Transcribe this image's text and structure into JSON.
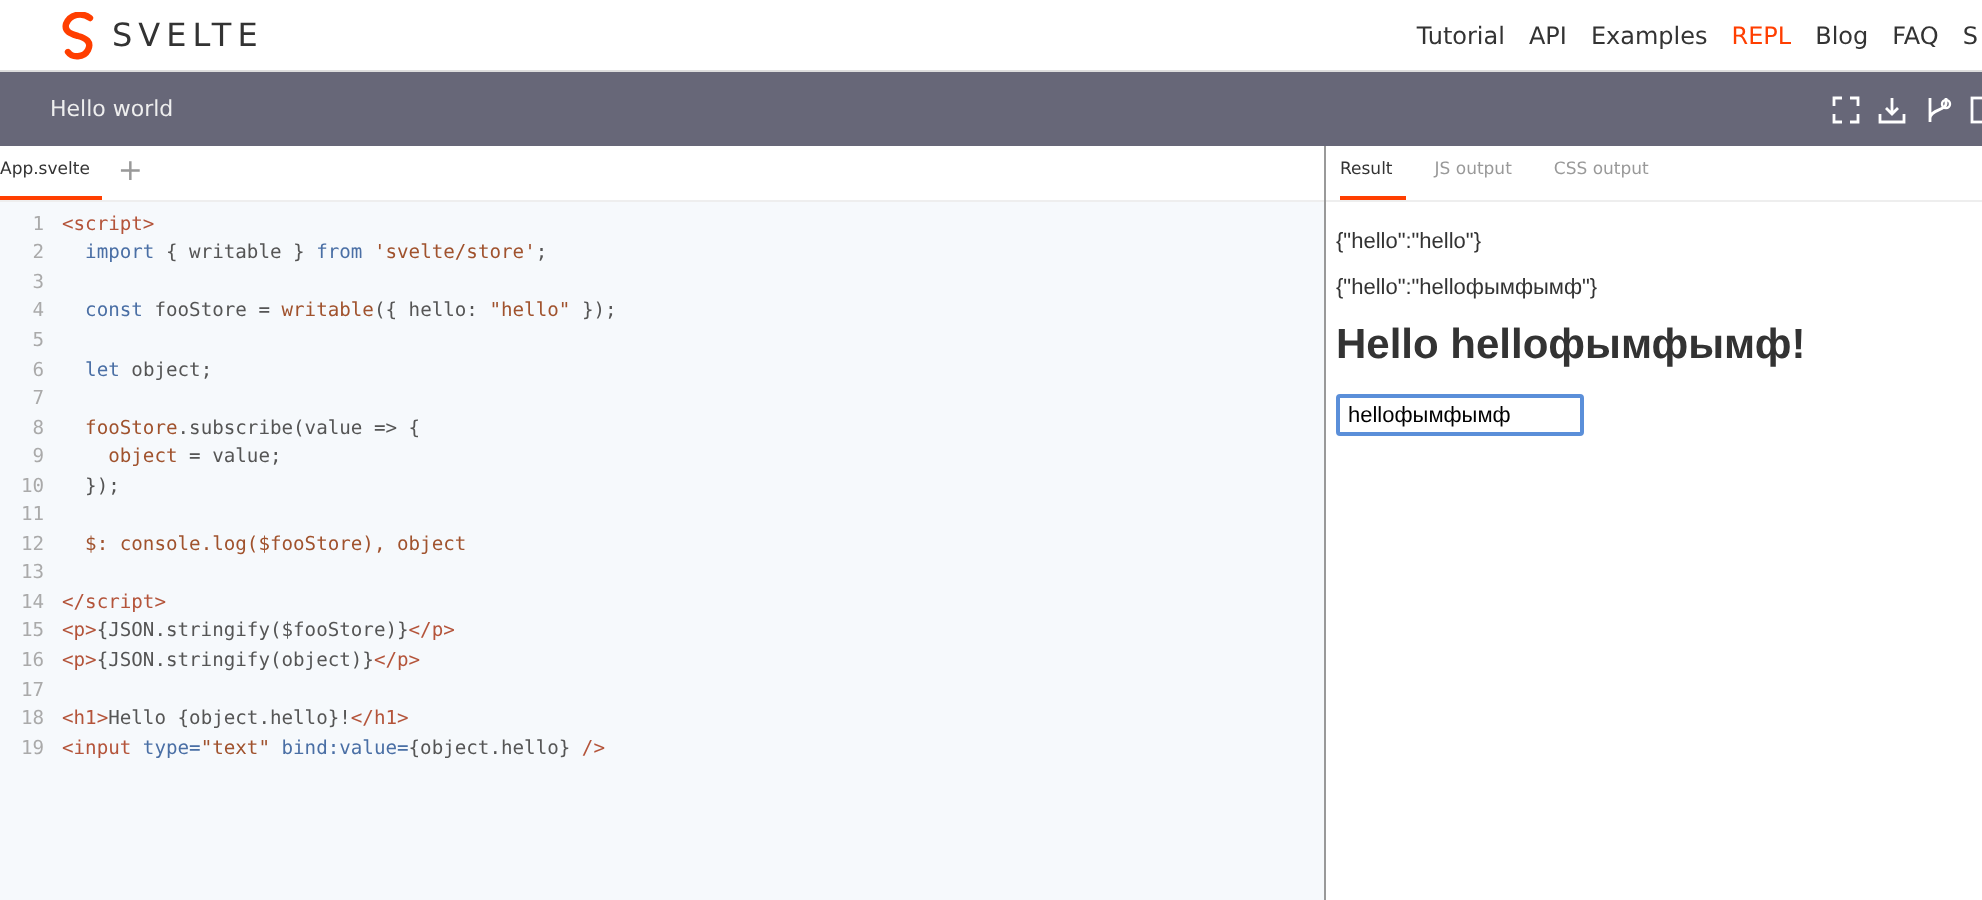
{
  "header": {
    "logo": "SVELTE",
    "nav": [
      {
        "label": "Tutorial",
        "selected": false
      },
      {
        "label": "API",
        "selected": false
      },
      {
        "label": "Examples",
        "selected": false
      },
      {
        "label": "REPL",
        "selected": true
      },
      {
        "label": "Blog",
        "selected": false
      },
      {
        "label": "FAQ",
        "selected": false
      },
      {
        "label": "S",
        "selected": false
      }
    ]
  },
  "toolbar": {
    "title": "Hello world"
  },
  "editor": {
    "tabs": [
      {
        "label": "App.svelte",
        "selected": true
      }
    ],
    "add_tab": "+",
    "lines": [
      {
        "number": "1",
        "tokens": [
          {
            "kind": "tag",
            "text": "<script>"
          }
        ]
      },
      {
        "number": "2",
        "tokens": [
          {
            "kind": "keyword",
            "text": "  import"
          },
          {
            "kind": "plain",
            "text": " { writable } "
          },
          {
            "kind": "keyword",
            "text": "from"
          },
          {
            "kind": "string",
            "text": " 'svelte/store'"
          },
          {
            "kind": "plain",
            "text": ";"
          }
        ]
      },
      {
        "number": "3"
      },
      {
        "number": "4",
        "tokens": [
          {
            "kind": "keyword",
            "text": "  const"
          },
          {
            "kind": "plain",
            "text": " fooStore = "
          },
          {
            "kind": "var",
            "text": "writable"
          },
          {
            "kind": "plain",
            "text": "({ hello: "
          },
          {
            "kind": "string",
            "text": "\"hello\""
          },
          {
            "kind": "plain",
            "text": " });"
          }
        ]
      },
      {
        "number": "5"
      },
      {
        "number": "6",
        "tokens": [
          {
            "kind": "keyword",
            "text": "  let"
          },
          {
            "kind": "plain",
            "text": " object;"
          }
        ]
      },
      {
        "number": "7"
      },
      {
        "number": "8",
        "tokens": [
          {
            "kind": "var",
            "text": "  fooStore"
          },
          {
            "kind": "plain",
            "text": ".subscribe(value => {"
          }
        ]
      },
      {
        "number": "9",
        "tokens": [
          {
            "kind": "var",
            "text": "    object"
          },
          {
            "kind": "plain",
            "text": " = value;"
          }
        ]
      },
      {
        "number": "10",
        "tokens": [
          {
            "kind": "plain",
            "text": "  });"
          }
        ]
      },
      {
        "number": "11"
      },
      {
        "number": "12",
        "tokens": [
          {
            "kind": "var",
            "text": "  $:"
          },
          {
            "kind": "var",
            "text": " console.log($fooStore), object"
          }
        ]
      },
      {
        "number": "13"
      },
      {
        "number": "14",
        "tokens": [
          {
            "kind": "tag",
            "text": "</script>"
          }
        ]
      },
      {
        "number": "15",
        "tokens": [
          {
            "kind": "tag",
            "text": "<p>"
          },
          {
            "kind": "plain",
            "text": "{JSON.stringify($fooStore)}"
          },
          {
            "kind": "tag",
            "text": "</p>"
          }
        ]
      },
      {
        "number": "16",
        "tokens": [
          {
            "kind": "tag",
            "text": "<p>"
          },
          {
            "kind": "plain",
            "text": "{JSON.stringify(object)}"
          },
          {
            "kind": "tag",
            "text": "</p>"
          }
        ]
      },
      {
        "number": "17"
      },
      {
        "number": "18",
        "tokens": [
          {
            "kind": "tag",
            "text": "<h1>"
          },
          {
            "kind": "plain",
            "text": "Hello {object.hello}!"
          },
          {
            "kind": "tag",
            "text": "</h1>"
          }
        ]
      },
      {
        "number": "19",
        "tokens": [
          {
            "kind": "tag",
            "text": "<input"
          },
          {
            "kind": "keyword",
            "text": " type="
          },
          {
            "kind": "string",
            "text": "\"text\""
          },
          {
            "kind": "keyword",
            "text": " bind:value="
          },
          {
            "kind": "plain",
            "text": "{object.hello}"
          },
          {
            "kind": "tag",
            "text": " />"
          }
        ]
      }
    ]
  },
  "output": {
    "tabs": [
      {
        "label": "Result",
        "selected": true
      },
      {
        "label": "JS output",
        "selected": false
      },
      {
        "label": "CSS output",
        "selected": false
      }
    ],
    "paragraphs": [
      "{\"hello\":\"hello\"}",
      "{\"hello\":\"helloфымфымф\"}"
    ],
    "heading": "Hello helloфымфымф!",
    "input": {
      "value": "helloфымфымф"
    }
  }
}
